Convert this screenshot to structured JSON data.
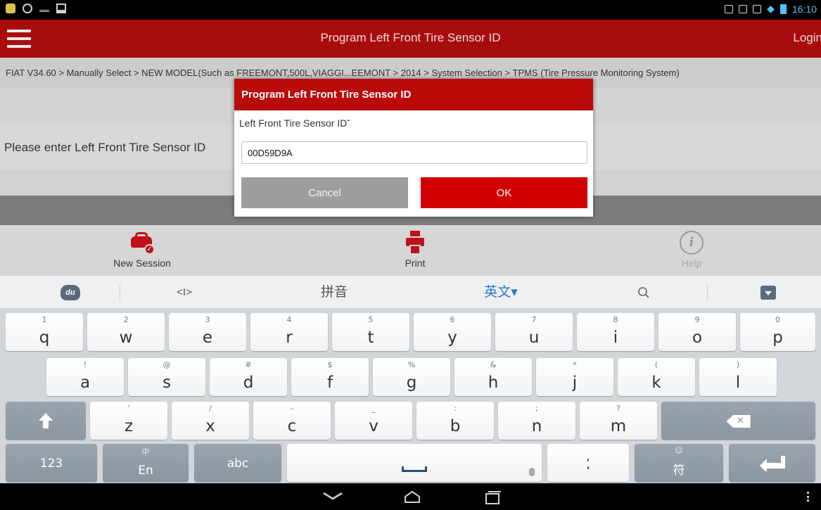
{
  "status_bar": {
    "clock": "16:10",
    "wifi_color": "#4ec3f5"
  },
  "title_bar": {
    "title": "Program Left Front Tire Sensor ID",
    "login": "Login",
    "color": "#a80d0d"
  },
  "breadcrumb": "FIAT V34.60 > Manually Select > NEW MODEL(Such as FREEMONT,500L,VIAGGI...EEMONT > 2014 > System Selection > TPMS (Tire Pressure Monitoring System)",
  "content": {
    "prompt": "Please enter Left Front Tire Sensor ID"
  },
  "toolbar": [
    {
      "label": "New Session",
      "icon": "car-check-icon"
    },
    {
      "label": "Print",
      "icon": "printer-icon"
    },
    {
      "label": "Help",
      "icon": "help-icon"
    }
  ],
  "dialog": {
    "title": "Program Left Front Tire Sensor ID",
    "label": "Left Front Tire Sensor ID˘",
    "input_value": "00D59D9A",
    "cancel": "Cancel",
    "ok": "OK",
    "accent": "#d00000"
  },
  "ime_bar": {
    "logo": "du",
    "cursor_tool": "<I>",
    "pinyin": "拼音",
    "english": "英文▾",
    "search_icon": "search-icon",
    "hide_icon": "hide-keyboard-icon"
  },
  "keyboard": {
    "row1": [
      {
        "main": "q",
        "sub": "1"
      },
      {
        "main": "w",
        "sub": "2"
      },
      {
        "main": "e",
        "sub": "3"
      },
      {
        "main": "r",
        "sub": "4"
      },
      {
        "main": "t",
        "sub": "5"
      },
      {
        "main": "y",
        "sub": "6"
      },
      {
        "main": "u",
        "sub": "7"
      },
      {
        "main": "i",
        "sub": "8"
      },
      {
        "main": "o",
        "sub": "9"
      },
      {
        "main": "p",
        "sub": "0"
      }
    ],
    "row2": [
      {
        "main": "a",
        "sub": "!"
      },
      {
        "main": "s",
        "sub": "@"
      },
      {
        "main": "d",
        "sub": "#"
      },
      {
        "main": "f",
        "sub": "$"
      },
      {
        "main": "g",
        "sub": "%"
      },
      {
        "main": "h",
        "sub": "&"
      },
      {
        "main": "j",
        "sub": "*"
      },
      {
        "main": "k",
        "sub": "("
      },
      {
        "main": "l",
        "sub": ")"
      }
    ],
    "row3": [
      {
        "main": "z",
        "sub": "'"
      },
      {
        "main": "x",
        "sub": "/"
      },
      {
        "main": "c",
        "sub": "–"
      },
      {
        "main": "v",
        "sub": "_"
      },
      {
        "main": "b",
        "sub": ":"
      },
      {
        "main": "n",
        "sub": ";"
      },
      {
        "main": "m",
        "sub": "?"
      }
    ],
    "row4": {
      "num": "123",
      "lang_sub": "中",
      "lang_main": "En",
      "abc": "abc",
      "comma_sub": ",",
      "comma_main": "·",
      "sym_sub": "☺",
      "sym_main": "符"
    }
  }
}
